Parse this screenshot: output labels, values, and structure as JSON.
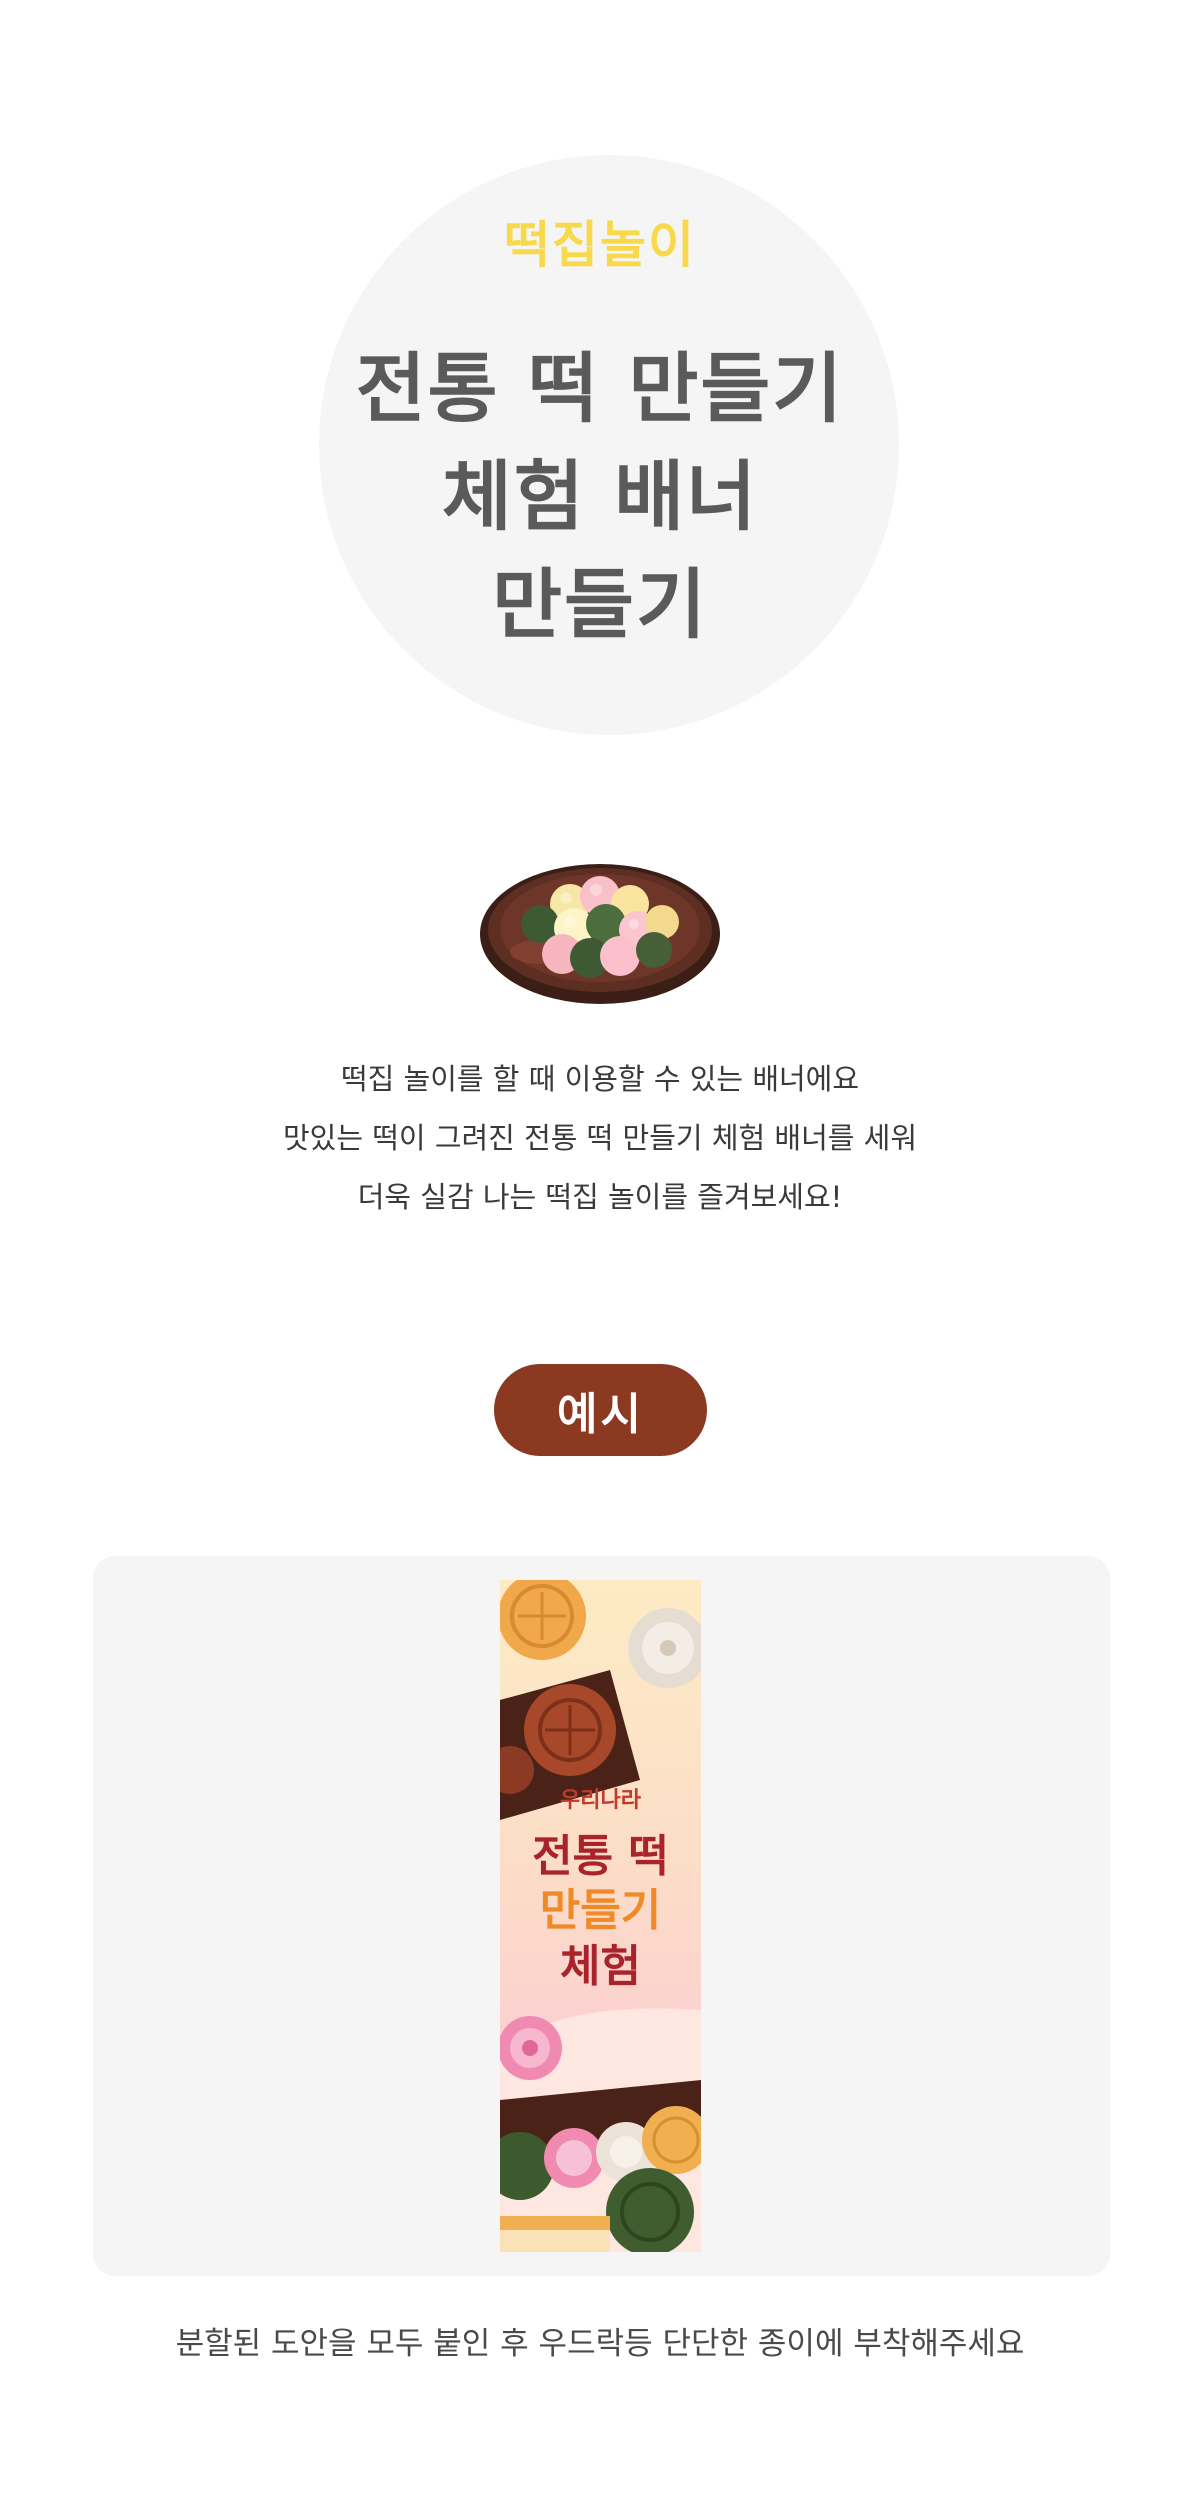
{
  "hero": {
    "subtitle": "떡집놀이",
    "title_lines": [
      "전통 떡 만들기",
      "체험 배너",
      "만들기"
    ]
  },
  "description": {
    "lines": [
      "떡집 놀이를 할 때 이용할 수 있는 배너에요",
      "맛있는 떡이 그려진 전통 떡 만들기 체험 배너를 세워",
      "더욱 실감 나는 떡집 놀이를 즐겨보세요!"
    ]
  },
  "example": {
    "badge": "예시",
    "banner": {
      "kicker": "우리나라",
      "line1": "전통 떡",
      "line2": "만들기",
      "line3": "체험"
    }
  },
  "footer_note": "분할된 도안을 모두 붙인 후 우드락등 단단한 종이에 부착해주세요",
  "colors": {
    "accent_yellow": "#f9d94c",
    "title_gray": "#5a5a5a",
    "badge_brown": "#8b3a21",
    "panel_gray": "#f5f5f5"
  }
}
